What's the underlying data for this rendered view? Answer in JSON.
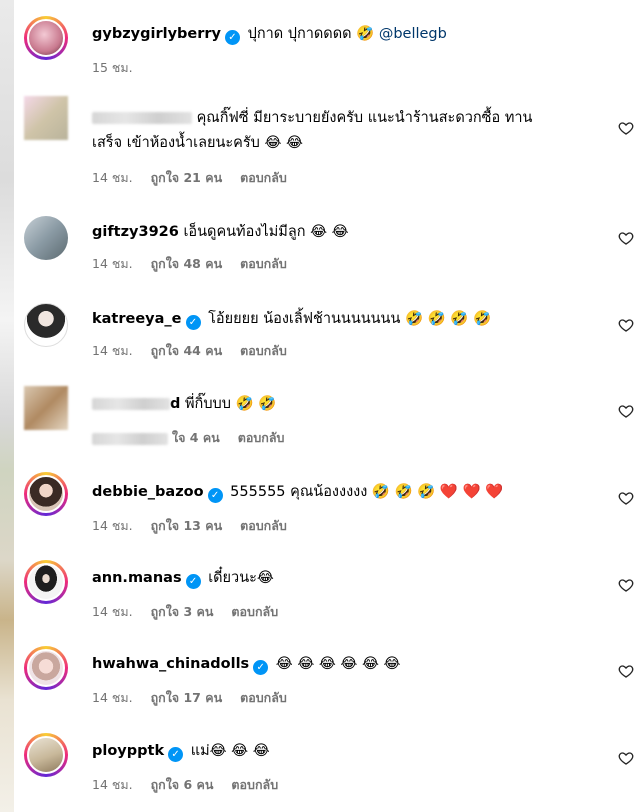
{
  "colors": {
    "link": "#00376b",
    "meta": "#737373",
    "verified": "#0095f6"
  },
  "post": {
    "username": "gybzygirlyberry",
    "verified": true,
    "caption": "ปุกาด ปุกาดดดด 🤣",
    "mention": "@bellegb",
    "time": "15 ชม."
  },
  "comments": [
    {
      "username": "",
      "verified": false,
      "text": "คุณกิ๊ฟซี่ มียาระบายยังครับ แนะนำร้านสะดวกซื้อ ทาน",
      "text2": "เสร็จ เข้าห้องน้ำเลยนะครับ 😂 😂",
      "time": "14 ชม.",
      "likes": "ถูกใจ 21 คน",
      "reply": "ตอบกลับ"
    },
    {
      "username": "giftzy3926",
      "verified": false,
      "text": "เอ็นดูคนท้องไม่มีลูก 😂 😂",
      "time": "14 ชม.",
      "likes": "ถูกใจ 48 คน",
      "reply": "ตอบกลับ"
    },
    {
      "username": "katreeya_e",
      "verified": true,
      "text": "โอ้ยยยย น้องเลิ้ฟช้านนนนนนน 🤣 🤣 🤣 🤣",
      "time": "14 ชม.",
      "likes": "ถูกใจ 44 คน",
      "reply": "ตอบกลับ"
    },
    {
      "username": "d",
      "verified": false,
      "text": "พี่กิ๊บบบ 🤣 🤣",
      "time": "",
      "likes": "ใจ 4 คน",
      "reply": "ตอบกลับ"
    },
    {
      "username": "debbie_bazoo",
      "verified": true,
      "text": "555555 คุณน้องงงงง 🤣 🤣 🤣 ❤️ ❤️ ❤️",
      "time": "14 ชม.",
      "likes": "ถูกใจ 13 คน",
      "reply": "ตอบกลับ"
    },
    {
      "username": "ann.manas",
      "verified": true,
      "text": "เดี๋ยวนะ😂",
      "time": "14 ชม.",
      "likes": "ถูกใจ 3 คน",
      "reply": "ตอบกลับ"
    },
    {
      "username": "hwahwa_chinadolls",
      "verified": true,
      "text": "😂 😂 😂 😂 😂 😂",
      "time": "14 ชม.",
      "likes": "ถูกใจ 17 คน",
      "reply": "ตอบกลับ"
    },
    {
      "username": "ploypptk",
      "verified": true,
      "text": "แม่😂 😂 😂",
      "time": "14 ชม.",
      "likes": "ถูกใจ 6 คน",
      "reply": "ตอบกลับ"
    }
  ]
}
